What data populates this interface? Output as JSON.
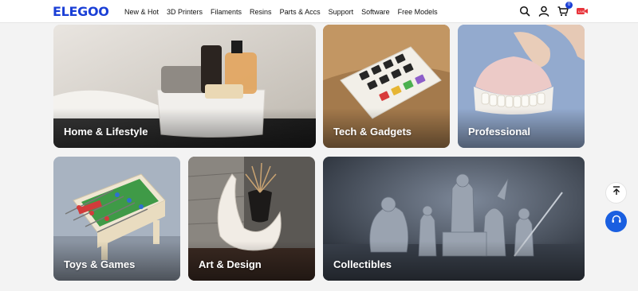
{
  "brand": {
    "logo": "ELEGOO",
    "accent": "#1a3fd6"
  },
  "nav": {
    "items": [
      "New & Hot",
      "3D Printers",
      "Filaments",
      "Resins",
      "Parts & Accs",
      "Support",
      "Software",
      "Free Models"
    ]
  },
  "header_icons": {
    "search": "search-icon",
    "account": "user-icon",
    "cart": "cart-icon",
    "cart_count": "0",
    "live": "live-video-icon"
  },
  "categories": [
    {
      "label": "Home & Lifestyle"
    },
    {
      "label": "Tech & Gadgets"
    },
    {
      "label": "Professional"
    },
    {
      "label": "Toys & Games"
    },
    {
      "label": "Art & Design"
    },
    {
      "label": "Collectibles"
    }
  ],
  "floating": {
    "top": "arrow-up-to-top-icon",
    "support": "headset-icon"
  }
}
